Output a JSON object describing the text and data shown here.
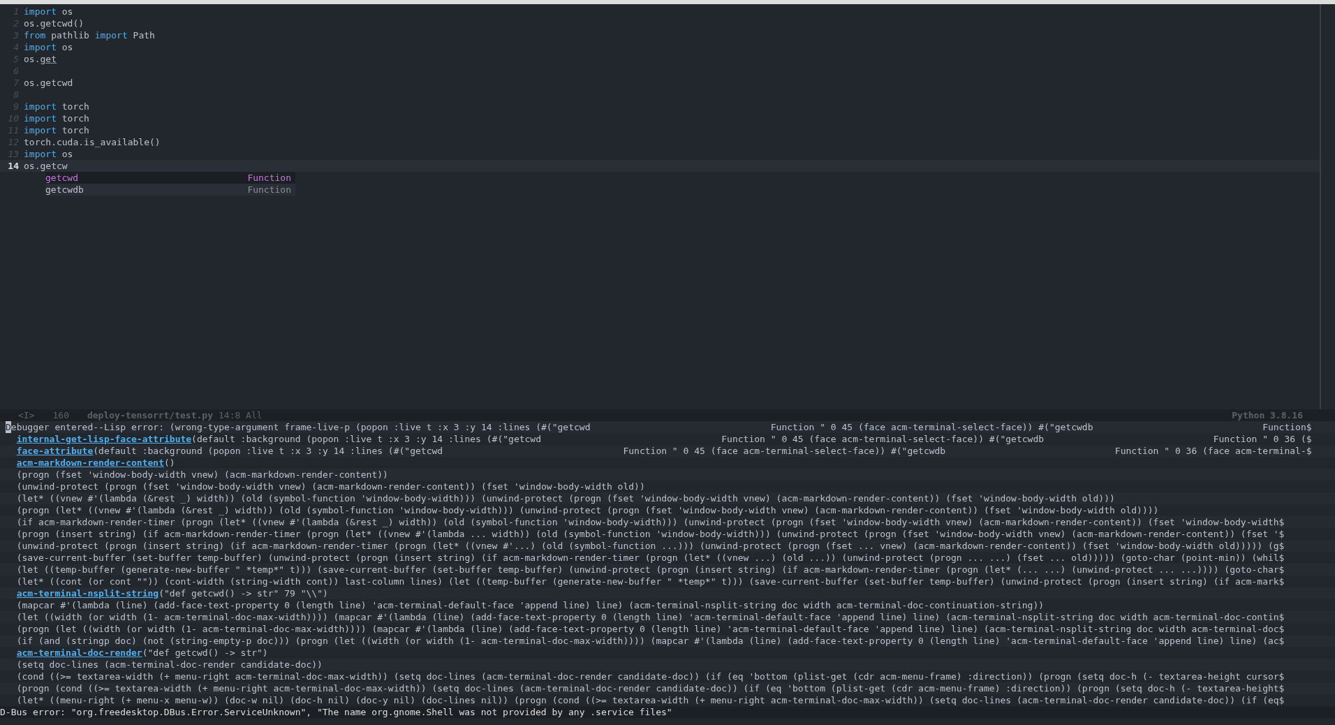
{
  "editor": {
    "lines": [
      {
        "number": "1",
        "current": false,
        "tokens": [
          {
            "text": "import",
            "kind": "keyword"
          },
          {
            "text": " os",
            "kind": "plain"
          }
        ]
      },
      {
        "number": "2",
        "current": false,
        "tokens": [
          {
            "text": "os.getcwd()",
            "kind": "plain"
          }
        ]
      },
      {
        "number": "3",
        "current": false,
        "tokens": [
          {
            "text": "from",
            "kind": "keyword"
          },
          {
            "text": " pathlib ",
            "kind": "plain"
          },
          {
            "text": "import",
            "kind": "keyword"
          },
          {
            "text": " Path",
            "kind": "plain"
          }
        ]
      },
      {
        "number": "4",
        "current": false,
        "tokens": [
          {
            "text": "import",
            "kind": "keyword"
          },
          {
            "text": " os",
            "kind": "plain"
          }
        ]
      },
      {
        "number": "5",
        "current": false,
        "tokens": [
          {
            "text": "os.",
            "kind": "plain"
          },
          {
            "text": "get",
            "kind": "underlined"
          }
        ]
      },
      {
        "number": "6",
        "current": false
      },
      {
        "number": "7",
        "current": false,
        "tokens": [
          {
            "text": "os.getcwd",
            "kind": "plain"
          }
        ]
      },
      {
        "number": "8",
        "current": false
      },
      {
        "number": "9",
        "current": false,
        "tokens": [
          {
            "text": "import",
            "kind": "keyword"
          },
          {
            "text": " torch",
            "kind": "plain"
          }
        ]
      },
      {
        "number": "10",
        "current": false,
        "tokens": [
          {
            "text": "import",
            "kind": "keyword"
          },
          {
            "text": " torch",
            "kind": "plain"
          }
        ]
      },
      {
        "number": "11",
        "current": false,
        "tokens": [
          {
            "text": "import",
            "kind": "keyword"
          },
          {
            "text": " torch",
            "kind": "plain"
          }
        ]
      },
      {
        "number": "12",
        "current": false,
        "tokens": [
          {
            "text": "torch.cuda.is_available()",
            "kind": "plain"
          }
        ]
      },
      {
        "number": "13",
        "current": false,
        "tokens": [
          {
            "text": "import",
            "kind": "keyword"
          },
          {
            "text": " os",
            "kind": "plain"
          }
        ]
      },
      {
        "number": "14",
        "current": true,
        "tokens": [
          {
            "text": "os.getcw",
            "kind": "plain"
          }
        ]
      }
    ],
    "completion": [
      {
        "label": "getcwd",
        "kind_label": "Function",
        "selected": true
      },
      {
        "label": "getcwdb",
        "kind_label": "Function",
        "selected": false
      }
    ]
  },
  "mode_line": {
    "state": "<I>",
    "size": "160",
    "file": "deploy-tensorrt/test.py",
    "position": "14:8 All",
    "mode": "Python 3.8.16"
  },
  "debugger": [
    {
      "kind": "header",
      "text": "Debugger entered--Lisp error: (wrong-type-argument frame-live-p (popon :live t :x 3 :y 14 :lines (#(\"getcwd                                 Function \" 0 45 (face acm-terminal-select-face)) #(\"getcwdb                               Function$"
    },
    {
      "kind": "frame",
      "function": "internal-get-lisp-face-attribute",
      "text": "(default :background (popon :live t :x 3 :y 14 :lines (#(\"getcwd                                 Function \" 0 45 (face acm-terminal-select-face)) #(\"getcwdb                               Function \" 0 36 ($"
    },
    {
      "kind": "frame",
      "function": "face-attribute",
      "text": "(default :background (popon :live t :x 3 :y 14 :lines (#(\"getcwd                                 Function \" 0 45 (face acm-terminal-select-face)) #(\"getcwdb                               Function \" 0 36 (face acm-terminal-$"
    },
    {
      "kind": "frame",
      "function": "acm-markdown-render-content",
      "text": "()"
    },
    {
      "kind": "form",
      "text": "(progn (fset 'window-body-width vnew) (acm-markdown-render-content))"
    },
    {
      "kind": "form",
      "text": "(unwind-protect (progn (fset 'window-body-width vnew) (acm-markdown-render-content)) (fset 'window-body-width old))"
    },
    {
      "kind": "form",
      "text": "(let* ((vnew #'(lambda (&rest _) width)) (old (symbol-function 'window-body-width))) (unwind-protect (progn (fset 'window-body-width vnew) (acm-markdown-render-content)) (fset 'window-body-width old)))"
    },
    {
      "kind": "form",
      "text": "(progn (let* ((vnew #'(lambda (&rest _) width)) (old (symbol-function 'window-body-width))) (unwind-protect (progn (fset 'window-body-width vnew) (acm-markdown-render-content)) (fset 'window-body-width old))))"
    },
    {
      "kind": "form",
      "text": "(if acm-markdown-render-timer (progn (let* ((vnew #'(lambda (&rest _) width)) (old (symbol-function 'window-body-width))) (unwind-protect (progn (fset 'window-body-width vnew) (acm-markdown-render-content)) (fset 'window-body-width$"
    },
    {
      "kind": "form",
      "text": "(progn (insert string) (if acm-markdown-render-timer (progn (let* ((vnew #'(lambda ... width)) (old (symbol-function 'window-body-width))) (unwind-protect (progn (fset 'window-body-width vnew) (acm-markdown-render-content)) (fset '$"
    },
    {
      "kind": "form",
      "text": "(unwind-protect (progn (insert string) (if acm-markdown-render-timer (progn (let* ((vnew #'...) (old (symbol-function ...))) (unwind-protect (progn (fset ... vnew) (acm-markdown-render-content)) (fset 'window-body-width old))))) (g$"
    },
    {
      "kind": "form",
      "text": "(save-current-buffer (set-buffer temp-buffer) (unwind-protect (progn (insert string) (if acm-markdown-render-timer (progn (let* ((vnew ...) (old ...)) (unwind-protect (progn ... ...) (fset ... old))))) (goto-char (point-min)) (whil$"
    },
    {
      "kind": "form",
      "text": "(let ((temp-buffer (generate-new-buffer \" *temp*\" t))) (save-current-buffer (set-buffer temp-buffer) (unwind-protect (progn (insert string) (if acm-markdown-render-timer (progn (let* (... ...) (unwind-protect ... ...)))) (goto-char$"
    },
    {
      "kind": "form",
      "text": "(let* ((cont (or cont \"\")) (cont-width (string-width cont)) last-column lines) (let ((temp-buffer (generate-new-buffer \" *temp*\" t))) (save-current-buffer (set-buffer temp-buffer) (unwind-protect (progn (insert string) (if acm-mark$"
    },
    {
      "kind": "frame",
      "function": "acm-terminal-nsplit-string",
      "text": "(\"def getcwd() -> str\" 79 \"\\\\\")"
    },
    {
      "kind": "form",
      "text": "(mapcar #'(lambda (line) (add-face-text-property 0 (length line) 'acm-terminal-default-face 'append line) line) (acm-terminal-nsplit-string doc width acm-terminal-doc-continuation-string))"
    },
    {
      "kind": "form",
      "text": "(let ((width (or width (1- acm-terminal-doc-max-width)))) (mapcar #'(lambda (line) (add-face-text-property 0 (length line) 'acm-terminal-default-face 'append line) line) (acm-terminal-nsplit-string doc width acm-terminal-doc-contin$"
    },
    {
      "kind": "form",
      "text": "(progn (let ((width (or width (1- acm-terminal-doc-max-width)))) (mapcar #'(lambda (line) (add-face-text-property 0 (length line) 'acm-terminal-default-face 'append line) line) (acm-terminal-nsplit-string doc width acm-terminal-doc$"
    },
    {
      "kind": "form",
      "text": "(if (and (stringp doc) (not (string-empty-p doc))) (progn (let ((width (or width (1- acm-terminal-doc-max-width)))) (mapcar #'(lambda (line) (add-face-text-property 0 (length line) 'acm-terminal-default-face 'append line) line) (ac$"
    },
    {
      "kind": "frame",
      "function": "acm-terminal-doc-render",
      "text": "(\"def getcwd() -> str\")"
    },
    {
      "kind": "form",
      "text": "(setq doc-lines (acm-terminal-doc-render candidate-doc))"
    },
    {
      "kind": "form",
      "text": "(cond ((>= textarea-width (+ menu-right acm-terminal-doc-max-width)) (setq doc-lines (acm-terminal-doc-render candidate-doc)) (if (eq 'bottom (plist-get (cdr acm-menu-frame) :direction)) (progn (setq doc-h (- textarea-height cursor$"
    },
    {
      "kind": "form",
      "text": "(progn (cond ((>= textarea-width (+ menu-right acm-terminal-doc-max-width)) (setq doc-lines (acm-terminal-doc-render candidate-doc)) (if (eq 'bottom (plist-get (cdr acm-menu-frame) :direction)) (progn (setq doc-h (- textarea-height$"
    },
    {
      "kind": "form",
      "text": "(let* ((menu-right (+ menu-x menu-w)) (doc-w nil) (doc-h nil) (doc-y nil) (doc-lines nil)) (progn (cond ((>= textarea-width (+ menu-right acm-terminal-doc-max-width)) (setq doc-lines (acm-terminal-doc-render candidate-doc)) (if (eq$"
    }
  ],
  "echo_area": "D-Bus error: \"org.freedesktop.DBus.Error.ServiceUnknown\", \"The name org.gnome.Shell was not provided by any .service files\""
}
